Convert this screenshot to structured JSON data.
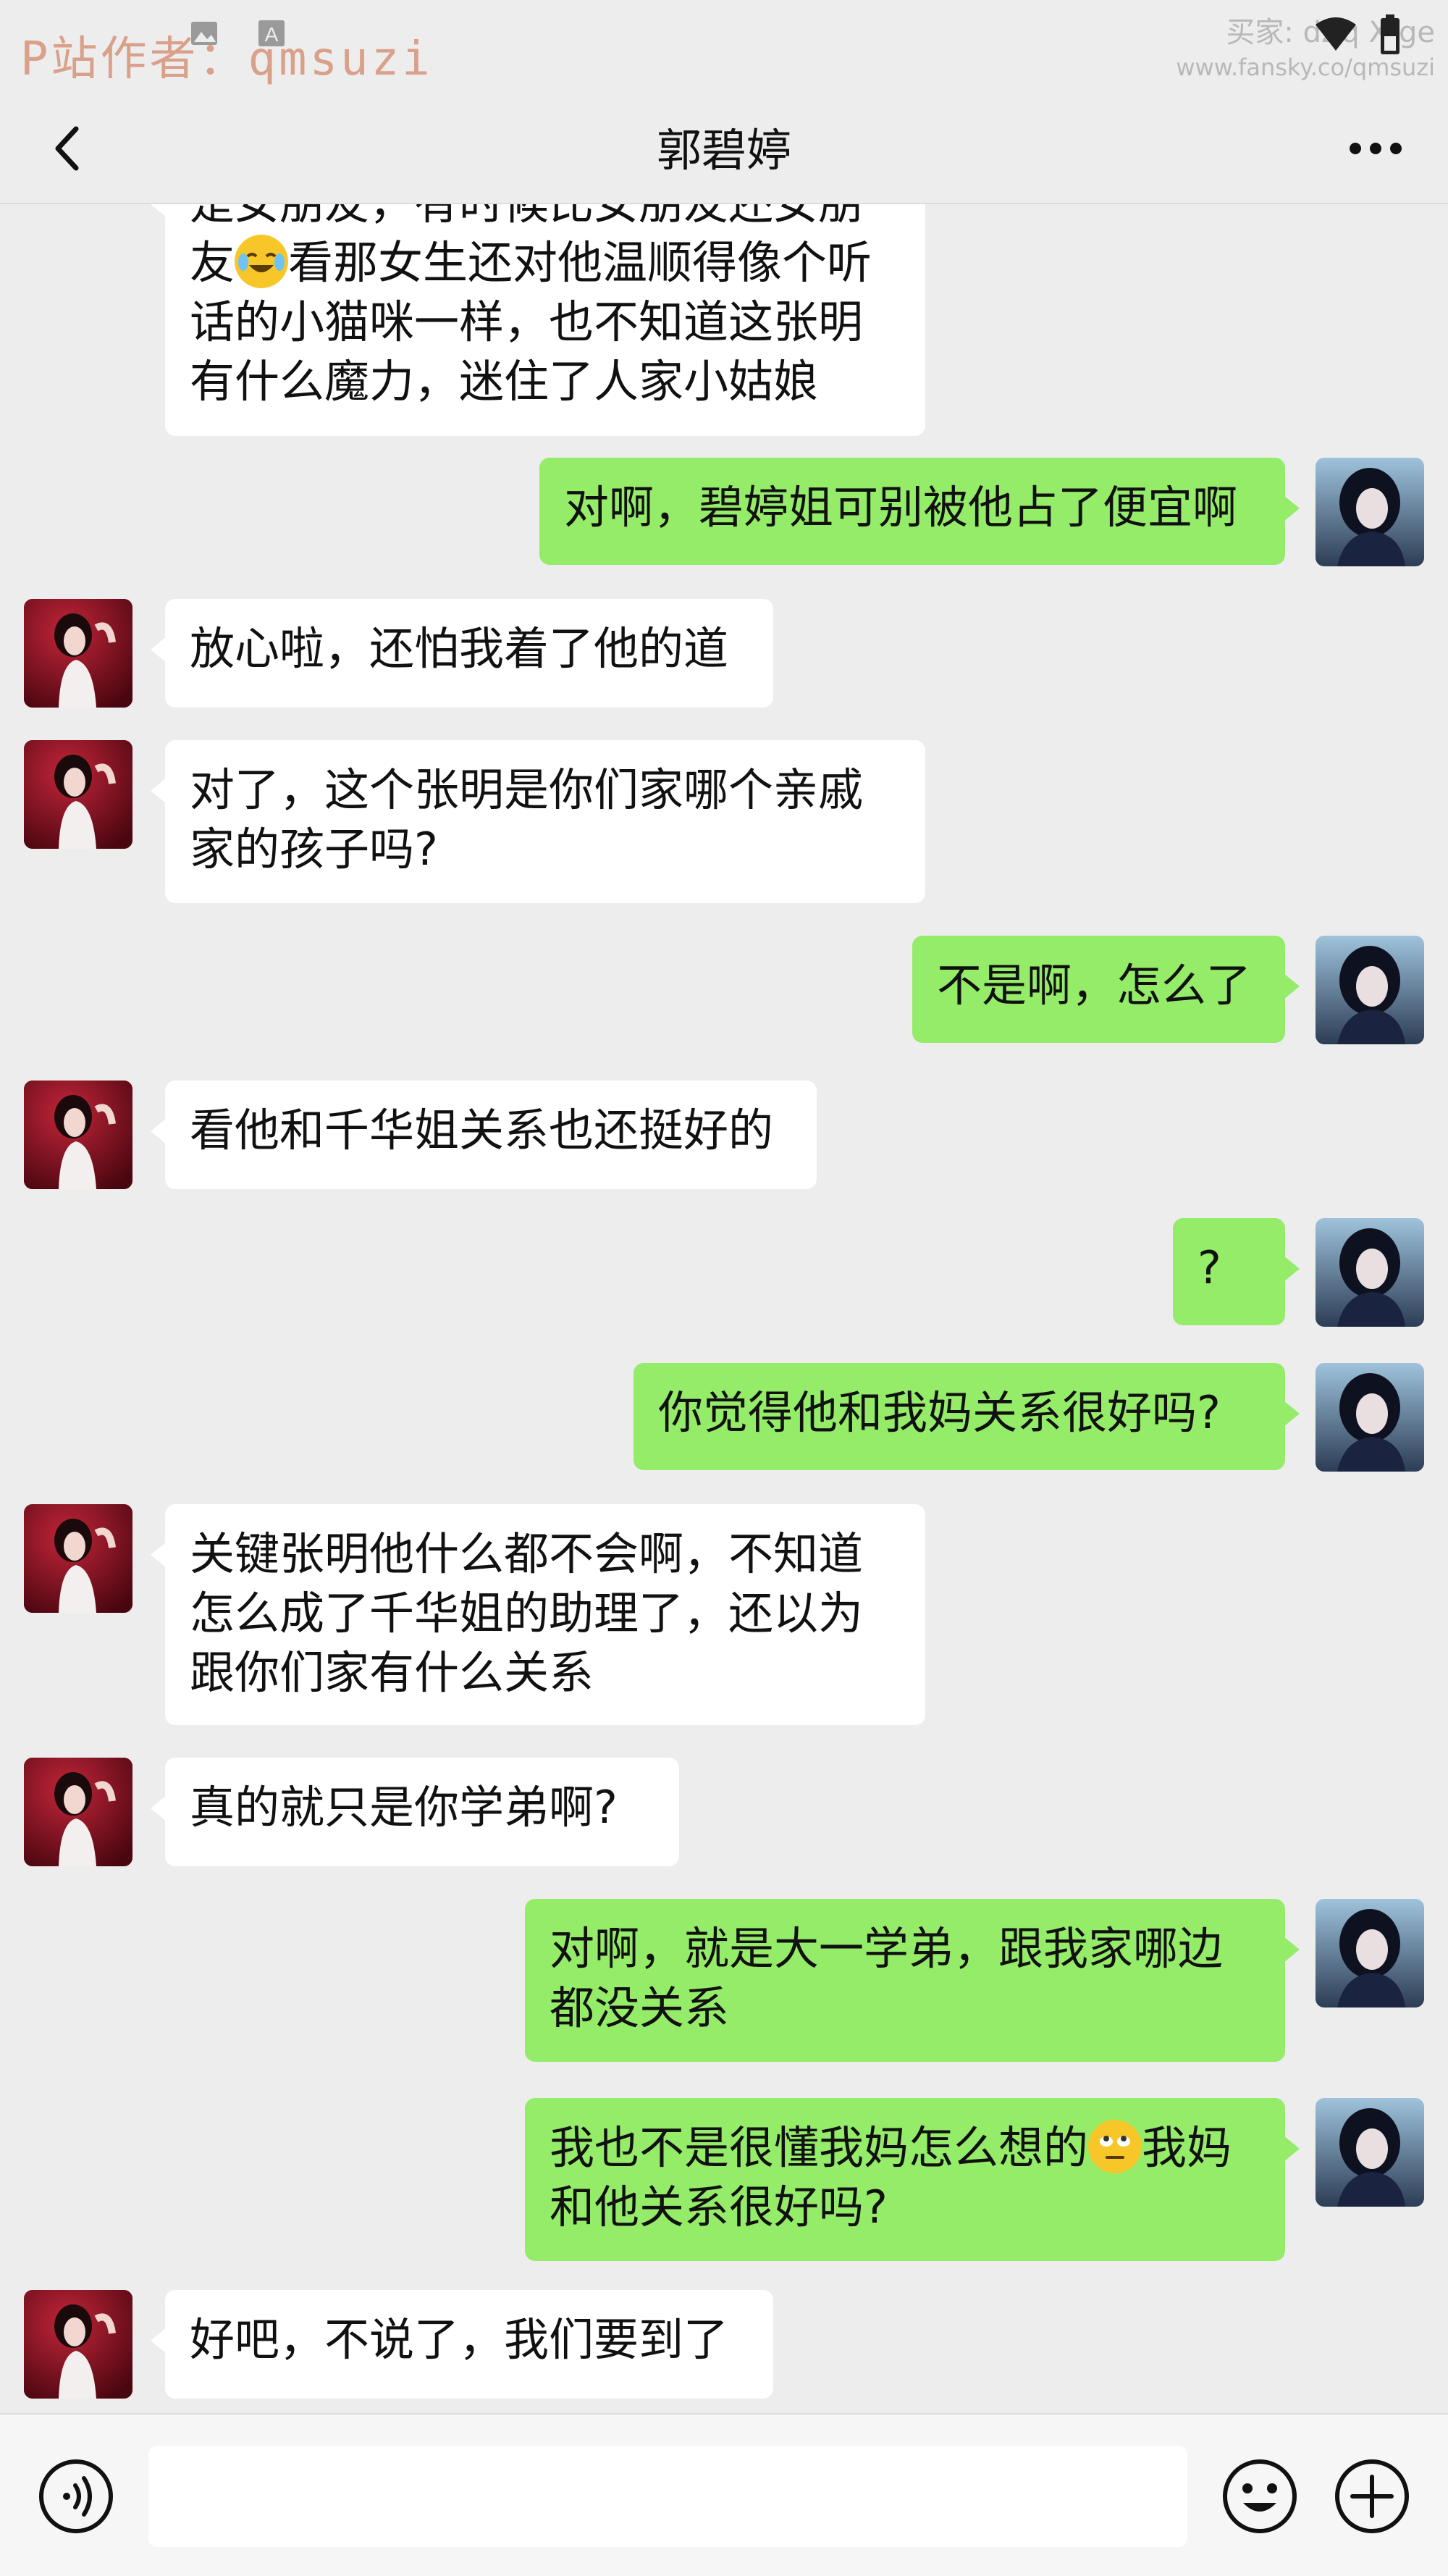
{
  "watermarks": {
    "left": "P站作者：qmsuzi",
    "right_line1": "买家: dZq   Xfge",
    "right_line2": "www.fansky.co/qmsuzi"
  },
  "header": {
    "title": "郭碧婷",
    "back_icon": "chevron-left-icon",
    "more_icon": "more-dots-icon"
  },
  "messages": [
    {
      "side": "left",
      "avatar": false,
      "text_before": "是女朋友，有时候比女朋友还女朋\n友",
      "emoji": "tears-of-joy-emoji",
      "text_after": "看那女生还对他温顺得像个听\n话的小猫咪一样，也不知道这张明\n有什么魔力，迷住了人家小姑娘"
    },
    {
      "side": "right",
      "text": "对啊，碧婷姐可别被他占了便宜啊"
    },
    {
      "side": "left",
      "text": "放心啦，还怕我着了他的道"
    },
    {
      "side": "left",
      "text": "对了，这个张明是你们家哪个亲戚\n家的孩子吗?"
    },
    {
      "side": "right",
      "text": "不是啊，怎么了"
    },
    {
      "side": "left",
      "text": "看他和千华姐关系也还挺好的"
    },
    {
      "side": "right",
      "text": "?"
    },
    {
      "side": "right",
      "text": "你觉得他和我妈关系很好吗?"
    },
    {
      "side": "left",
      "text": "关键张明他什么都不会啊，不知道\n怎么成了千华姐的助理了，还以为\n跟你们家有什么关系"
    },
    {
      "side": "left",
      "text": "真的就只是你学弟啊?"
    },
    {
      "side": "right",
      "text": "对啊，就是大一学弟，跟我家哪边\n都没关系"
    },
    {
      "side": "right",
      "text_before": "我也不是很懂我妈怎么想的",
      "emoji": "rolling-eyes-emoji",
      "text_after": "我妈\n和他关系很好吗?"
    },
    {
      "side": "left",
      "text": "好吧，不说了，我们要到了"
    }
  ],
  "bottom_bar": {
    "voice_icon": "voice-icon",
    "emoji_icon": "smiley-icon",
    "plus_icon": "plus-icon",
    "input_value": ""
  },
  "colors": {
    "background": "#ededed",
    "self_bubble": "#95ec69",
    "other_bubble": "#ffffff"
  }
}
